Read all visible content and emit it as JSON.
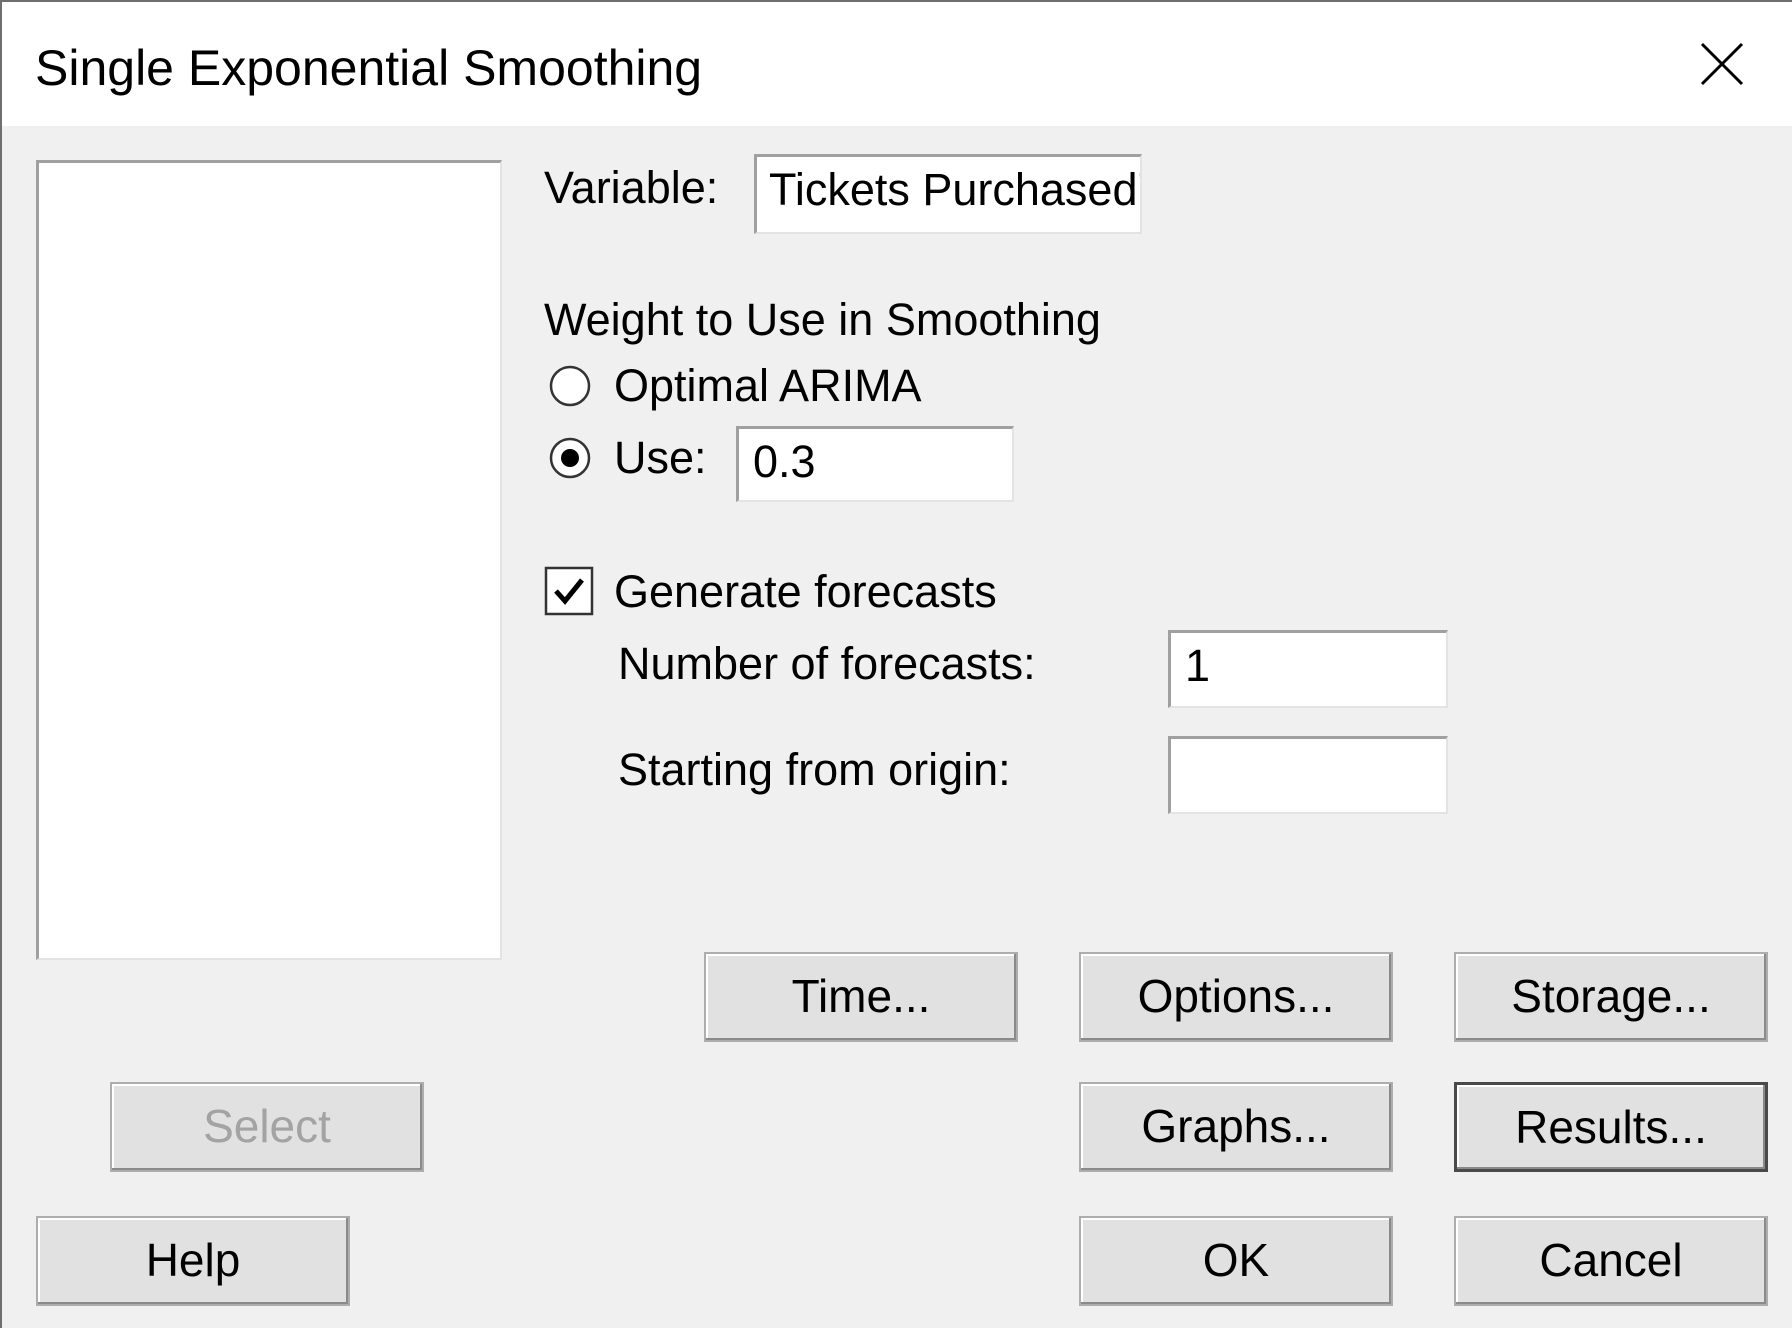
{
  "window": {
    "title": "Single Exponential Smoothing",
    "close_icon": "close-icon"
  },
  "variable": {
    "label": "Variable:",
    "value": "Tickets Purchased'"
  },
  "weight": {
    "heading": "Weight to Use in Smoothing",
    "options": [
      {
        "label": "Optimal ARIMA",
        "selected": false
      },
      {
        "label": "Use:",
        "selected": true
      }
    ],
    "use_value": "0.3"
  },
  "forecasts": {
    "generate_label": "Generate forecasts",
    "generate_checked": true,
    "number_label": "Number of forecasts:",
    "number_value": "1",
    "origin_label": "Starting from origin:",
    "origin_value": ""
  },
  "buttons": {
    "time": "Time...",
    "options": "Options...",
    "storage": "Storage...",
    "select": "Select",
    "graphs": "Graphs...",
    "results": "Results...",
    "help": "Help",
    "ok": "OK",
    "cancel": "Cancel"
  }
}
